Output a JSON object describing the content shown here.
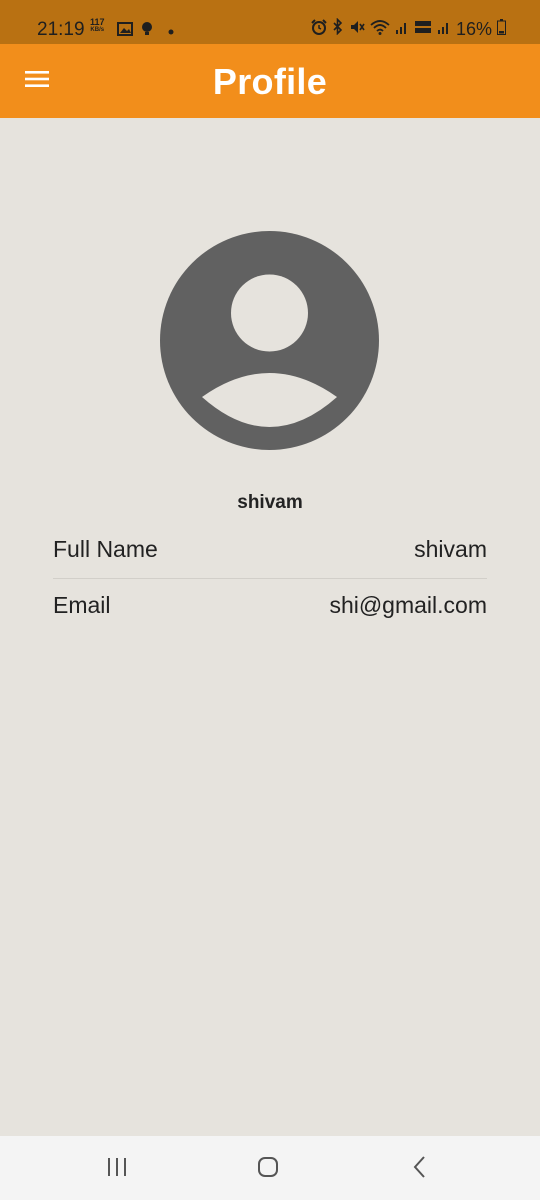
{
  "status_bar": {
    "time": "21:19",
    "net_speed_value": "117",
    "net_speed_unit": "KB/s",
    "battery_percent": "16%",
    "icons": [
      "gallery-icon",
      "bulb-icon",
      "dot-icon",
      "alarm-icon",
      "bluetooth-icon",
      "mute-icon",
      "wifi-icon",
      "signal-icon",
      "volte-icon",
      "signal-icon",
      "battery-icon"
    ]
  },
  "app_bar": {
    "title": "Profile",
    "menu_icon": "hamburger-menu-icon",
    "background": "#f28e1b"
  },
  "profile": {
    "avatar_icon": "user-avatar-icon",
    "username": "shivam",
    "fields": [
      {
        "label": "Full Name",
        "value": "shivam"
      },
      {
        "label": "Email",
        "value": "shi@gmail.com"
      }
    ]
  },
  "nav_bar": {
    "buttons": [
      "recent-apps-icon",
      "home-icon",
      "back-icon"
    ]
  },
  "colors": {
    "status_bar": "#b97112",
    "page_background": "#e6e3dd",
    "avatar": "#616161"
  }
}
